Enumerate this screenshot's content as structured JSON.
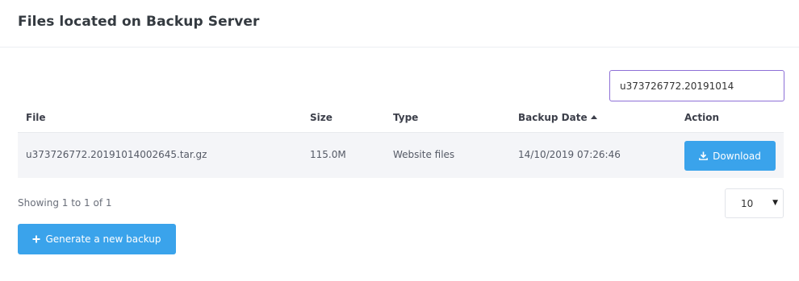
{
  "header": {
    "title": "Files located on Backup Server"
  },
  "search": {
    "value": "u373726772.20191014"
  },
  "table": {
    "columns": {
      "file": "File",
      "size": "Size",
      "type": "Type",
      "date": "Backup Date",
      "action": "Action"
    },
    "sort": {
      "column": "Backup Date",
      "direction": "ascending",
      "icon": "caret-up-icon"
    },
    "rows": [
      {
        "file": "u373726772.20191014002645.tar.gz",
        "size": "115.0M",
        "type": "Website files",
        "date": "14/10/2019 07:26:46",
        "action_label": "Download"
      }
    ]
  },
  "footer": {
    "showing": "Showing 1 to 1 of 1",
    "page_size": "10"
  },
  "actions": {
    "generate_label": "Generate a new backup"
  },
  "colors": {
    "accent": "#3aa3eb",
    "focus_border": "#8d6fd6",
    "row_background": "#f4f5f8"
  }
}
